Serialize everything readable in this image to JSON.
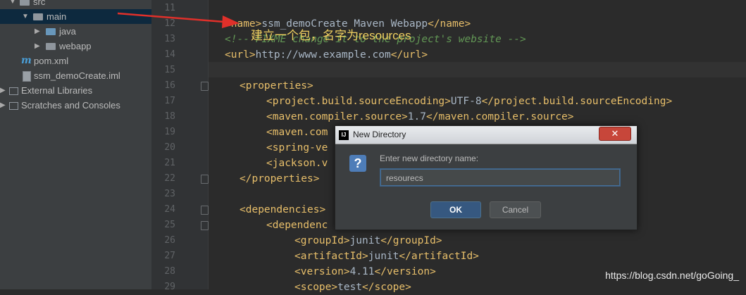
{
  "project_tree": {
    "items": [
      {
        "label": "src",
        "icon": "folder-icon",
        "arrow": "▼"
      },
      {
        "label": "main",
        "icon": "folder-icon",
        "arrow": "▼",
        "selected": true
      },
      {
        "label": "java",
        "icon": "folder-blue-icon",
        "arrow": "▶"
      },
      {
        "label": "webapp",
        "icon": "folder-icon",
        "arrow": "▶"
      },
      {
        "label": "pom.xml",
        "icon": "maven-icon"
      },
      {
        "label": "ssm_demoCreate.iml",
        "icon": "module-file-icon"
      },
      {
        "label": "External Libraries",
        "icon": "library-icon",
        "arrow": "▶"
      },
      {
        "label": "Scratches and Consoles",
        "icon": "scratches-icon",
        "arrow": "▶"
      }
    ]
  },
  "editor": {
    "line_numbers": [
      "11",
      "12",
      "13",
      "14",
      "15",
      "16",
      "17",
      "18",
      "19",
      "20",
      "21",
      "22",
      "23",
      "24",
      "25",
      "26",
      "27",
      "28",
      "29"
    ],
    "lines": {
      "l12_a": "<name>",
      "l12_b": "ssm_demoCreate Maven Webapp",
      "l12_c": "</name>",
      "l13": "<!-- FIXME change it to the project's website -->",
      "l14_a": "<url>",
      "l14_b": "http://www.example.com",
      "l14_c": "</url>",
      "l16": "<properties>",
      "l17_a": "<project.build.sourceEncoding>",
      "l17_b": "UTF-8",
      "l17_c": "</project.build.sourceEncoding>",
      "l18_a": "<maven.compiler.source>",
      "l18_b": "1.7",
      "l18_c": "</maven.compiler.source>",
      "l19": "<maven.com",
      "l20": "<spring-ve",
      "l21": "<jackson.v",
      "l22": "</properties>",
      "l24": "<dependencies>",
      "l25": "<dependenc",
      "l26_a": "<groupId>",
      "l26_b": "junit",
      "l26_c": "</groupId>",
      "l27_a": "<artifactId>",
      "l27_b": "junit",
      "l27_c": "</artifactId>",
      "l28_a": "<version>",
      "l28_b": "4.11",
      "l28_c": "</version>",
      "l29_a": "<scope>",
      "l29_b": "test",
      "l29_c": "</scope>"
    }
  },
  "annotation": {
    "text": "建立一个包，名字为resources",
    "color": "#f0d060"
  },
  "dialog": {
    "title": "New Directory",
    "close_glyph": "✕",
    "app_icon": "IJ",
    "question_glyph": "?",
    "prompt": "Enter new directory name:",
    "input_value": "resourecs",
    "ok_label": "OK",
    "cancel_label": "Cancel"
  },
  "watermark": "https://blog.csdn.net/goGoing_",
  "colors": {
    "tag": "#e8bf6a",
    "text": "#a9b7c6",
    "comment": "#629755",
    "ok_button": "#365880",
    "arrow": "#e0302a"
  }
}
